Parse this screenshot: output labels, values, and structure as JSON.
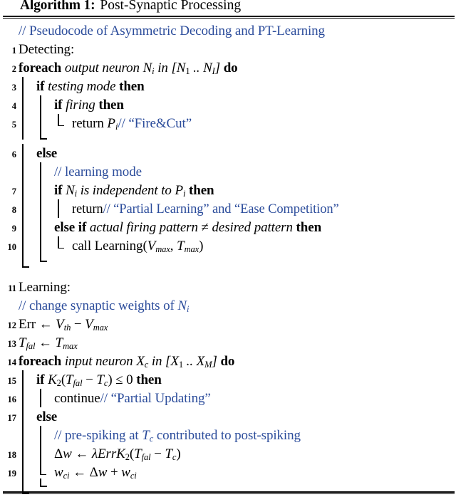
{
  "header": {
    "algorithm_label": "Algorithm 1:",
    "title": "Post-Synaptic Processing"
  },
  "lines": [
    {
      "no": "",
      "indent": 0,
      "kind": "comment",
      "text": "// Pseudocode of Asymmetric Decoding and PT-Learning"
    },
    {
      "no": "1",
      "indent": 0,
      "kind": "stmt",
      "text": "Detecting:"
    },
    {
      "no": "2",
      "indent": 0,
      "kind": "foreach",
      "text": "foreach output neuron Ni in [N1 .. NI] do"
    },
    {
      "no": "3",
      "indent": 1,
      "kind": "if",
      "text": "if testing mode then"
    },
    {
      "no": "4",
      "indent": 2,
      "kind": "if",
      "text": "if firing then"
    },
    {
      "no": "5",
      "indent": 3,
      "kind": "stmt",
      "text": "return Pi// \"Fire&Cut\""
    },
    {
      "no": "6",
      "indent": 1,
      "kind": "else",
      "text": "else"
    },
    {
      "no": "",
      "indent": 2,
      "kind": "comment",
      "text": "// learning mode"
    },
    {
      "no": "7",
      "indent": 2,
      "kind": "if",
      "text": "if Ni is independent to Pi then"
    },
    {
      "no": "8",
      "indent": 3,
      "kind": "stmt",
      "text": "return// \"Partial Learning\" and \"Ease Competition\""
    },
    {
      "no": "9",
      "indent": 2,
      "kind": "elseif",
      "text": "else if actual firing pattern ≠ desired pattern then"
    },
    {
      "no": "10",
      "indent": 3,
      "kind": "stmt",
      "text": "call Learning(Vmax, Tmax)"
    },
    {
      "no": "11",
      "indent": 0,
      "kind": "stmt",
      "text": "Learning:"
    },
    {
      "no": "",
      "indent": 0,
      "kind": "comment",
      "text": "// change synaptic weights of Ni"
    },
    {
      "no": "12",
      "indent": 0,
      "kind": "assign",
      "text": "Err ← Vth − Vmax"
    },
    {
      "no": "13",
      "indent": 0,
      "kind": "assign",
      "text": "Tfal ← Tmax"
    },
    {
      "no": "14",
      "indent": 0,
      "kind": "foreach",
      "text": "foreach input neuron Xc in [X1 .. XM] do"
    },
    {
      "no": "15",
      "indent": 1,
      "kind": "if",
      "text": "if K2(Tfal − Tc) ⩽ 0 then"
    },
    {
      "no": "16",
      "indent": 2,
      "kind": "stmt",
      "text": "continue// \"Partial Updating\""
    },
    {
      "no": "17",
      "indent": 1,
      "kind": "else",
      "text": "else"
    },
    {
      "no": "",
      "indent": 2,
      "kind": "comment",
      "text": "// pre-spiking at Tc contributed to post-spiking"
    },
    {
      "no": "18",
      "indent": 2,
      "kind": "assign",
      "text": "Δw ← λErrK2(Tfal − Tc)"
    },
    {
      "no": "19",
      "indent": 2,
      "kind": "assign",
      "text": "wci ← Δw + wci"
    }
  ],
  "colors": {
    "comment_blue": "#2b4c9b",
    "text_black": "#000000",
    "background": "#ffffff"
  },
  "keywords": {
    "foreach": "foreach",
    "do": "do",
    "if": "if",
    "then": "then",
    "else": "else",
    "else_if": "else if",
    "return": "return",
    "continue": "continue",
    "call": "call"
  },
  "comments": {
    "c1": "// Pseudocode of Asymmetric Decoding and PT-Learning",
    "c2": "// learning mode",
    "c3": "// change synaptic weights of ",
    "c4": "// pre-spiking at ",
    "c4b": " contributed to post-spiking",
    "fire_cut": "// “Fire&Cut”",
    "partial_learning": "// “Partial Learning” and “Ease Competition”",
    "partial_updating": "// “Partial Updating”"
  },
  "labels": {
    "detecting": "Detecting:",
    "learning": "Learning:"
  },
  "line_numbers": [
    "1",
    "2",
    "3",
    "4",
    "5",
    "6",
    "7",
    "8",
    "9",
    "10",
    "11",
    "12",
    "13",
    "14",
    "15",
    "16",
    "17",
    "18",
    "19"
  ]
}
